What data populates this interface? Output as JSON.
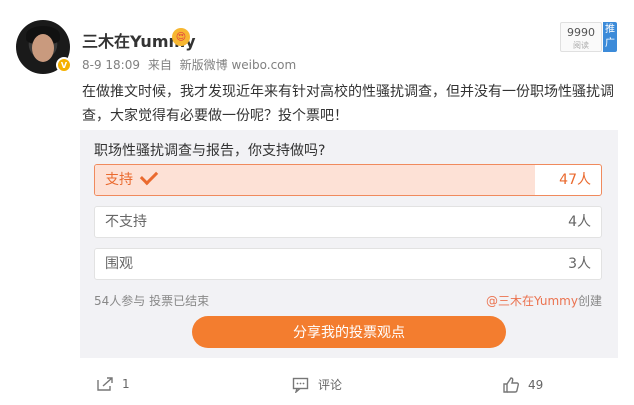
{
  "user": {
    "name": "三木在Yummy",
    "verified_badge": "V",
    "emoji": "😍",
    "time": "8-9 18:09",
    "via_label": "来自",
    "source": "新版微博 weibo.com"
  },
  "promo": {
    "count": "9990",
    "label": "阅读",
    "tag": "推广"
  },
  "post": {
    "text": "在做推文时候，我才发现近年来有针对高校的性骚扰调查，但并没有一份职场性骚扰调查，大家觉得有必要做一份呢？投个票吧！"
  },
  "poll": {
    "question": "职场性骚扰调查与报告，你支持做吗?",
    "options": [
      {
        "label": "支持",
        "count": "47人",
        "selected": true,
        "share": 0.87
      },
      {
        "label": "不支持",
        "count": "4人",
        "selected": false,
        "share": 0.07
      },
      {
        "label": "围观",
        "count": "3人",
        "selected": false,
        "share": 0.06
      }
    ],
    "stats": "54人参与 投票已结束",
    "creator_handle": "@三木在Yummy",
    "creator_suffix": "创建",
    "share_button": "分享我的投票观点"
  },
  "footer": {
    "forward_count": "1",
    "comment_label": "评论",
    "like_count": "49"
  },
  "colors": {
    "accent": "#f37d2f",
    "selected_fill": "#fde1d6",
    "poll_bg": "#f2f2f5"
  }
}
